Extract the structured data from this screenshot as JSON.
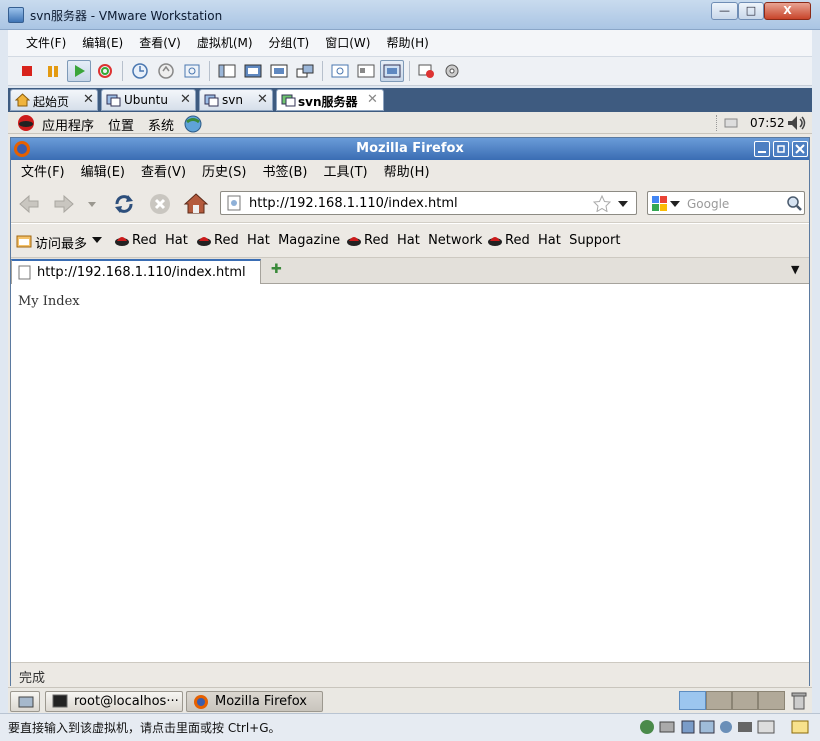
{
  "window": {
    "title": "svn服务器 - VMware Workstation",
    "minimize_glyph": "—",
    "maximize_glyph": "□",
    "close_glyph": "X"
  },
  "vm_menu": [
    "文件(F)",
    "编辑(E)",
    "查看(V)",
    "虚拟机(M)",
    "分组(T)",
    "窗口(W)",
    "帮助(H)"
  ],
  "vm_tabs": [
    {
      "label": "起始页",
      "icon": "home-icon",
      "selected": false
    },
    {
      "label": "Ubuntu",
      "icon": "vm-icon",
      "selected": false
    },
    {
      "label": "svn",
      "icon": "vm-icon",
      "selected": false
    },
    {
      "label": "svn服务器",
      "icon": "vm-icon",
      "selected": true
    }
  ],
  "tab_close_glyph": "✕",
  "gnome_panel": {
    "menus": [
      "应用程序",
      "位置",
      "系统"
    ],
    "clock": "07:52"
  },
  "firefox": {
    "title": "Mozilla Firefox",
    "menu": [
      "文件(F)",
      "编辑(E)",
      "查看(V)",
      "历史(S)",
      "书签(B)",
      "工具(T)",
      "帮助(H)"
    ],
    "url": "http://192.168.1.110/index.html",
    "search_placeholder": "Google",
    "bookmarks": {
      "most_visited": "访问最多",
      "items": [
        "Red  Hat",
        "Red  Hat  Magazine",
        "Red  Hat  Network",
        "Red  Hat  Support"
      ]
    },
    "tab_title": "http://192.168.1.110/index.html",
    "new_tab_glyph": "✚",
    "tab_list_glyph": "▼",
    "page_content": "My Index",
    "status": "完成"
  },
  "taskbar": {
    "items": [
      "root@localhos···",
      "Mozilla Firefox"
    ]
  },
  "vm_status": "要直接输入到该虚拟机，请点击里面或按 Ctrl+G。",
  "colors": {
    "vm_title_bg": "#aac5e4",
    "vm_tabstrip_bg": "#3e5b80",
    "firefox_title_bg": "#3a6db3",
    "gnome_bg": "#ece9e4"
  }
}
